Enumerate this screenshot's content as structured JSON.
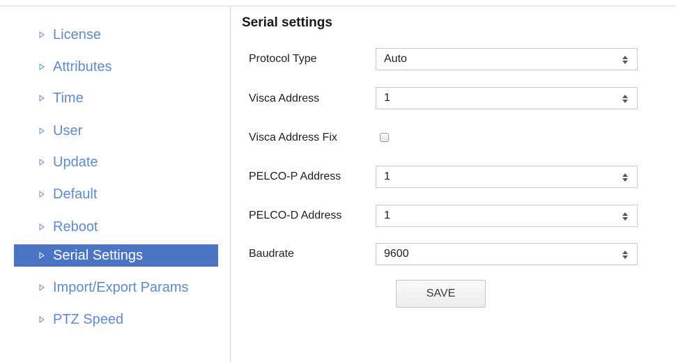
{
  "sidebar": {
    "items": [
      {
        "label": "License",
        "active": false
      },
      {
        "label": "Attributes",
        "active": false
      },
      {
        "label": "Time",
        "active": false
      },
      {
        "label": "User",
        "active": false
      },
      {
        "label": "Update",
        "active": false
      },
      {
        "label": "Default",
        "active": false
      },
      {
        "label": "Reboot",
        "active": false
      },
      {
        "label": "Serial Settings",
        "active": true
      },
      {
        "label": "Import/Export Params",
        "active": false
      },
      {
        "label": "PTZ Speed",
        "active": false
      }
    ]
  },
  "main": {
    "title": "Serial settings",
    "fields": {
      "protocol_type": {
        "label": "Protocol Type",
        "value": "Auto"
      },
      "visca_address": {
        "label": "Visca Address",
        "value": "1"
      },
      "visca_address_fix": {
        "label": "Visca Address Fix",
        "checked": false
      },
      "pelco_p_address": {
        "label": "PELCO-P Address",
        "value": "1"
      },
      "pelco_d_address": {
        "label": "PELCO-D Address",
        "value": "1"
      },
      "baudrate": {
        "label": "Baudrate",
        "value": "9600"
      }
    },
    "save_label": "SAVE"
  },
  "icons": {
    "sidebar_bullet": "triangle-right-icon",
    "select_arrows": "sort-arrows-icon"
  },
  "colors": {
    "link": "#5e8ad0",
    "active_bg": "#4a74c4",
    "active_text": "#ffffff"
  }
}
